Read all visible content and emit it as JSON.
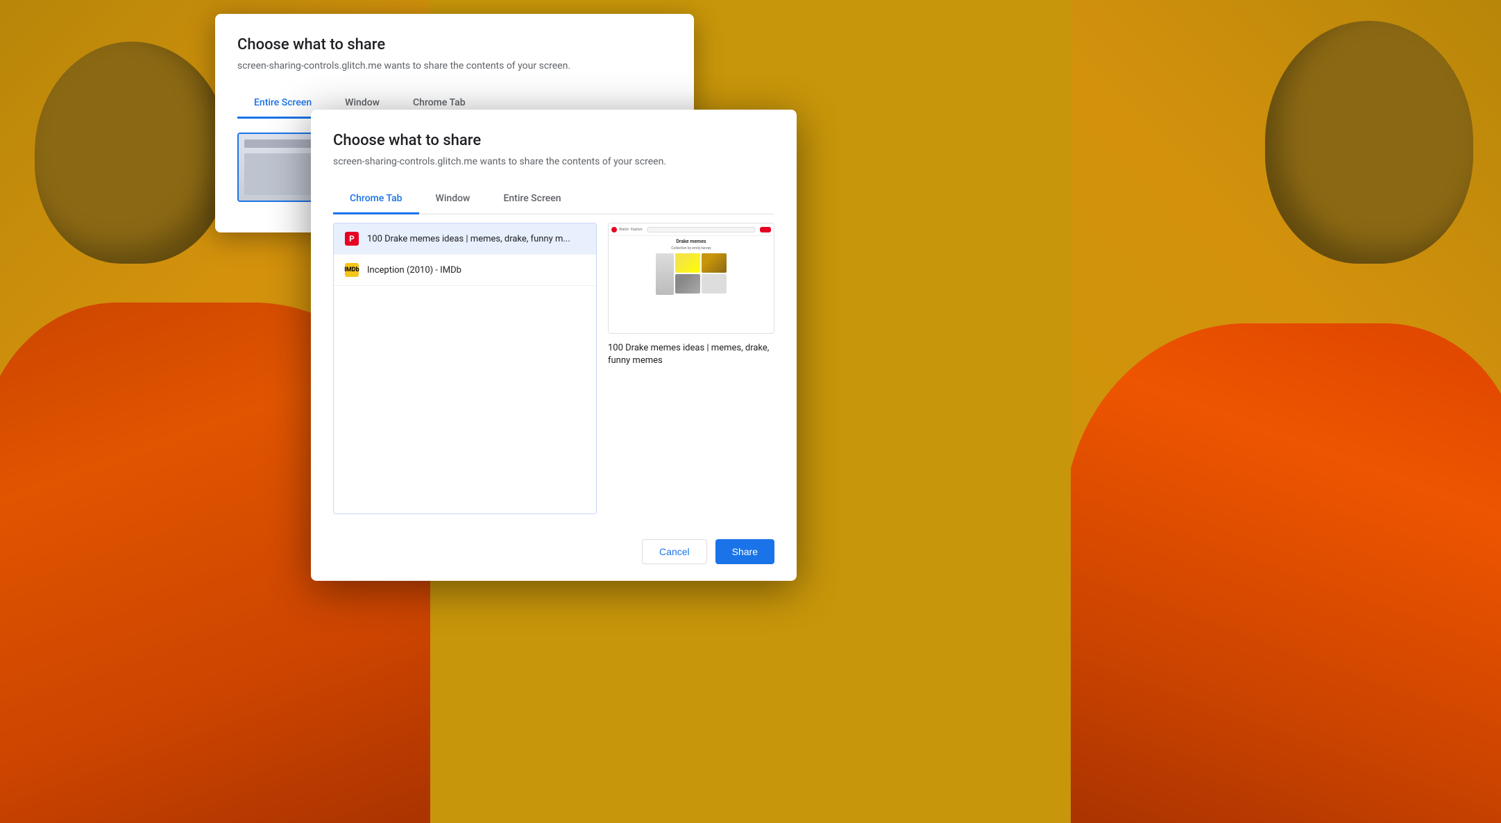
{
  "background": {
    "color": "#c8960a"
  },
  "dialog_back": {
    "title": "Choose what to share",
    "subtitle": "screen-sharing-controls.glitch.me wants to share the contents of your screen.",
    "tabs": [
      {
        "label": "Entire Screen",
        "active": true
      },
      {
        "label": "Window",
        "active": false
      },
      {
        "label": "Chrome Tab",
        "active": false
      }
    ]
  },
  "dialog_front": {
    "title": "Choose what to share",
    "subtitle": "screen-sharing-controls.glitch.me wants to share the contents of your screen.",
    "tabs": [
      {
        "label": "Chrome Tab",
        "active": true
      },
      {
        "label": "Window",
        "active": false
      },
      {
        "label": "Entire Screen",
        "active": false
      }
    ],
    "tab_list": [
      {
        "favicon_type": "pinterest",
        "favicon_label": "P",
        "title": "100 Drake memes ideas | memes, drake, funny m...",
        "selected": true
      },
      {
        "favicon_type": "imdb",
        "favicon_label": "IMDb",
        "title": "Inception (2010) - IMDb",
        "selected": false
      }
    ],
    "preview": {
      "caption": "100 Drake memes ideas | memes, drake, funny memes"
    },
    "footer": {
      "cancel_label": "Cancel",
      "share_label": "Share"
    }
  }
}
